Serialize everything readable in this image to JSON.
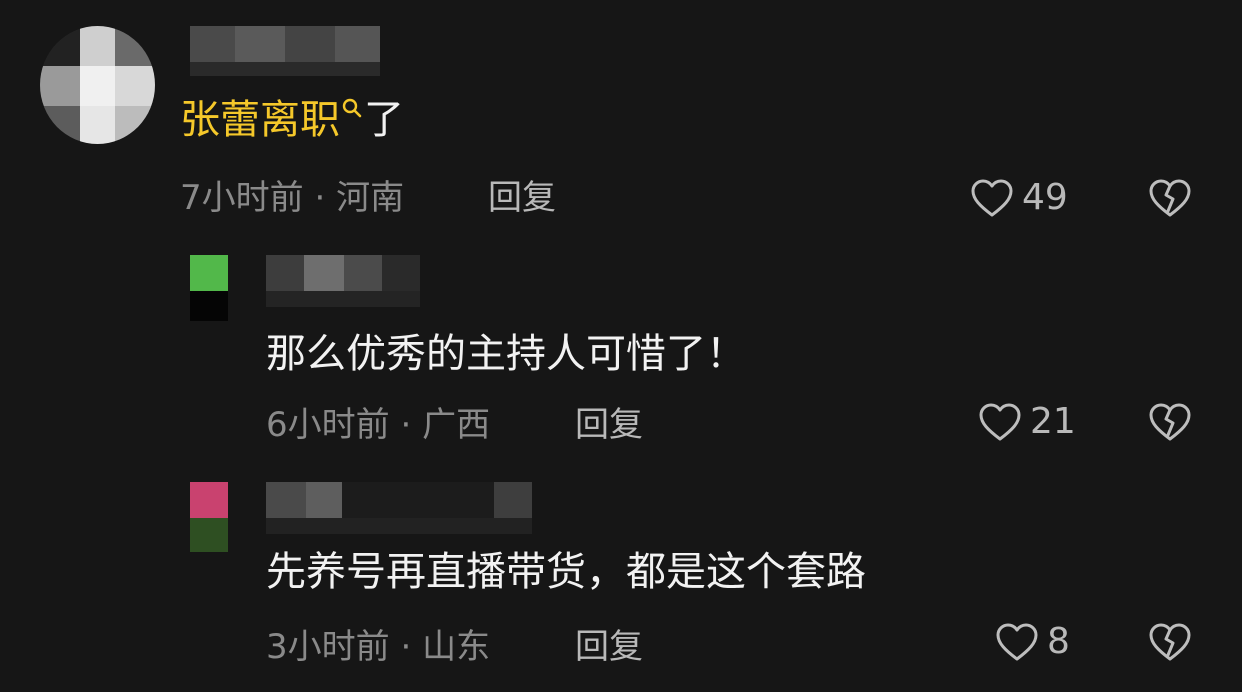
{
  "comments": [
    {
      "text_highlight": "张蕾离职",
      "text_rest": "了",
      "time": "7小时前",
      "location": "河南",
      "reply_label": "回复",
      "likes": "49"
    },
    {
      "text": "那么优秀的主持人可惜了！",
      "time": "6小时前",
      "location": "广西",
      "reply_label": "回复",
      "likes": "21"
    },
    {
      "text": "先养号再直播带货，都是这个套路",
      "time": "3小时前",
      "location": "山东",
      "reply_label": "回复",
      "likes": "8"
    }
  ],
  "meta_separator": "·",
  "colors": {
    "background": "#161616",
    "highlight": "#f5c82a",
    "text": "#f2f2f2",
    "meta": "#8a8a8a"
  },
  "icons": [
    "search-icon",
    "heart-icon",
    "broken-heart-icon"
  ]
}
